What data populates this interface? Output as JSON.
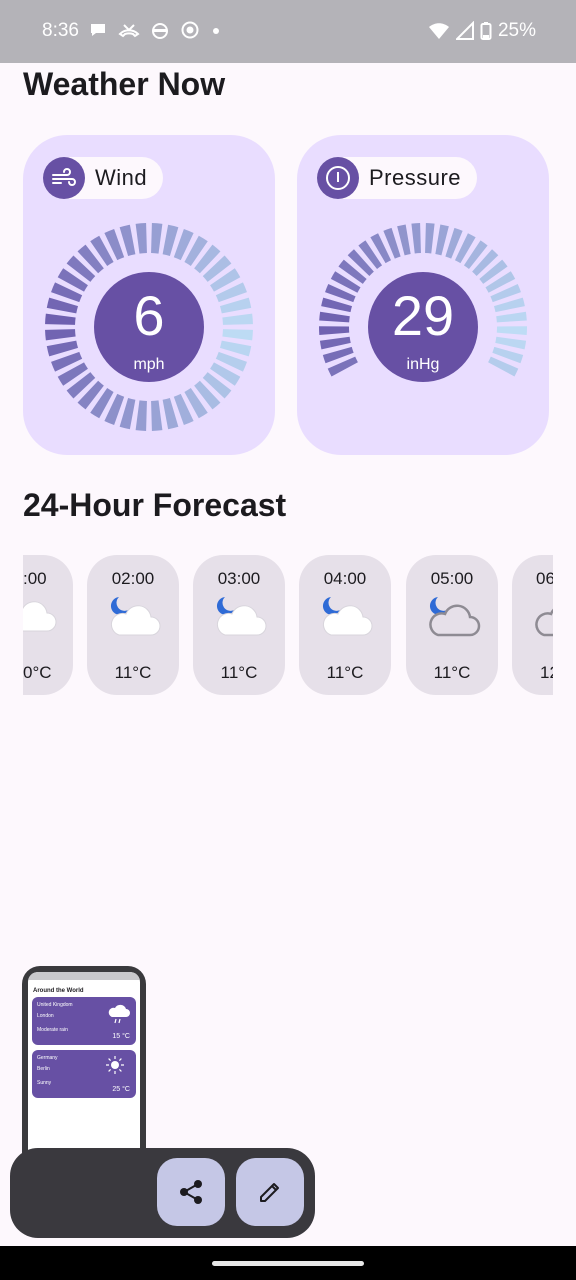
{
  "status_bar": {
    "time": "8:36",
    "battery": "25%",
    "icons": [
      "chat-bubble-icon",
      "missed-call-icon",
      "android-face-icon",
      "screen-record-icon",
      "dot-icon",
      "wifi-icon",
      "signal-icon",
      "battery-icon"
    ]
  },
  "weather_now": {
    "title": "Weather Now",
    "wind": {
      "label": "Wind",
      "value": "6",
      "unit": "mph",
      "icon": "wind-icon"
    },
    "pressure": {
      "label": "Pressure",
      "value": "29",
      "unit": "inHg",
      "icon": "gauge-icon"
    }
  },
  "forecast": {
    "title": "24-Hour Forecast",
    "hours": [
      {
        "time": ":00",
        "temp": "0°C",
        "icon": "cloud-icon"
      },
      {
        "time": "02:00",
        "temp": "11°C",
        "icon": "partly-cloudy-night-icon"
      },
      {
        "time": "03:00",
        "temp": "11°C",
        "icon": "partly-cloudy-night-icon"
      },
      {
        "time": "04:00",
        "temp": "11°C",
        "icon": "partly-cloudy-night-icon"
      },
      {
        "time": "05:00",
        "temp": "11°C",
        "icon": "partly-cloudy-night-icon"
      },
      {
        "time": "06",
        "temp": "12",
        "icon": "cloud-icon"
      }
    ]
  },
  "preview": {
    "title": "Around the World",
    "cards": [
      {
        "country": "United Kingdom",
        "city": "London",
        "condition": "Moderate rain",
        "temp": "15 °C",
        "icon": "rain-cloud-icon"
      },
      {
        "country": "Germany",
        "city": "Berlin",
        "condition": "Sunny",
        "temp": "25 °C",
        "icon": "sun-icon"
      }
    ]
  },
  "toolbar": {
    "share_icon": "share-icon",
    "edit_icon": "edit-icon"
  },
  "colors": {
    "primary": "#6750a4",
    "card": "#e9ddff",
    "surface": "#fdf8fd",
    "chip": "#e6e0e9"
  }
}
